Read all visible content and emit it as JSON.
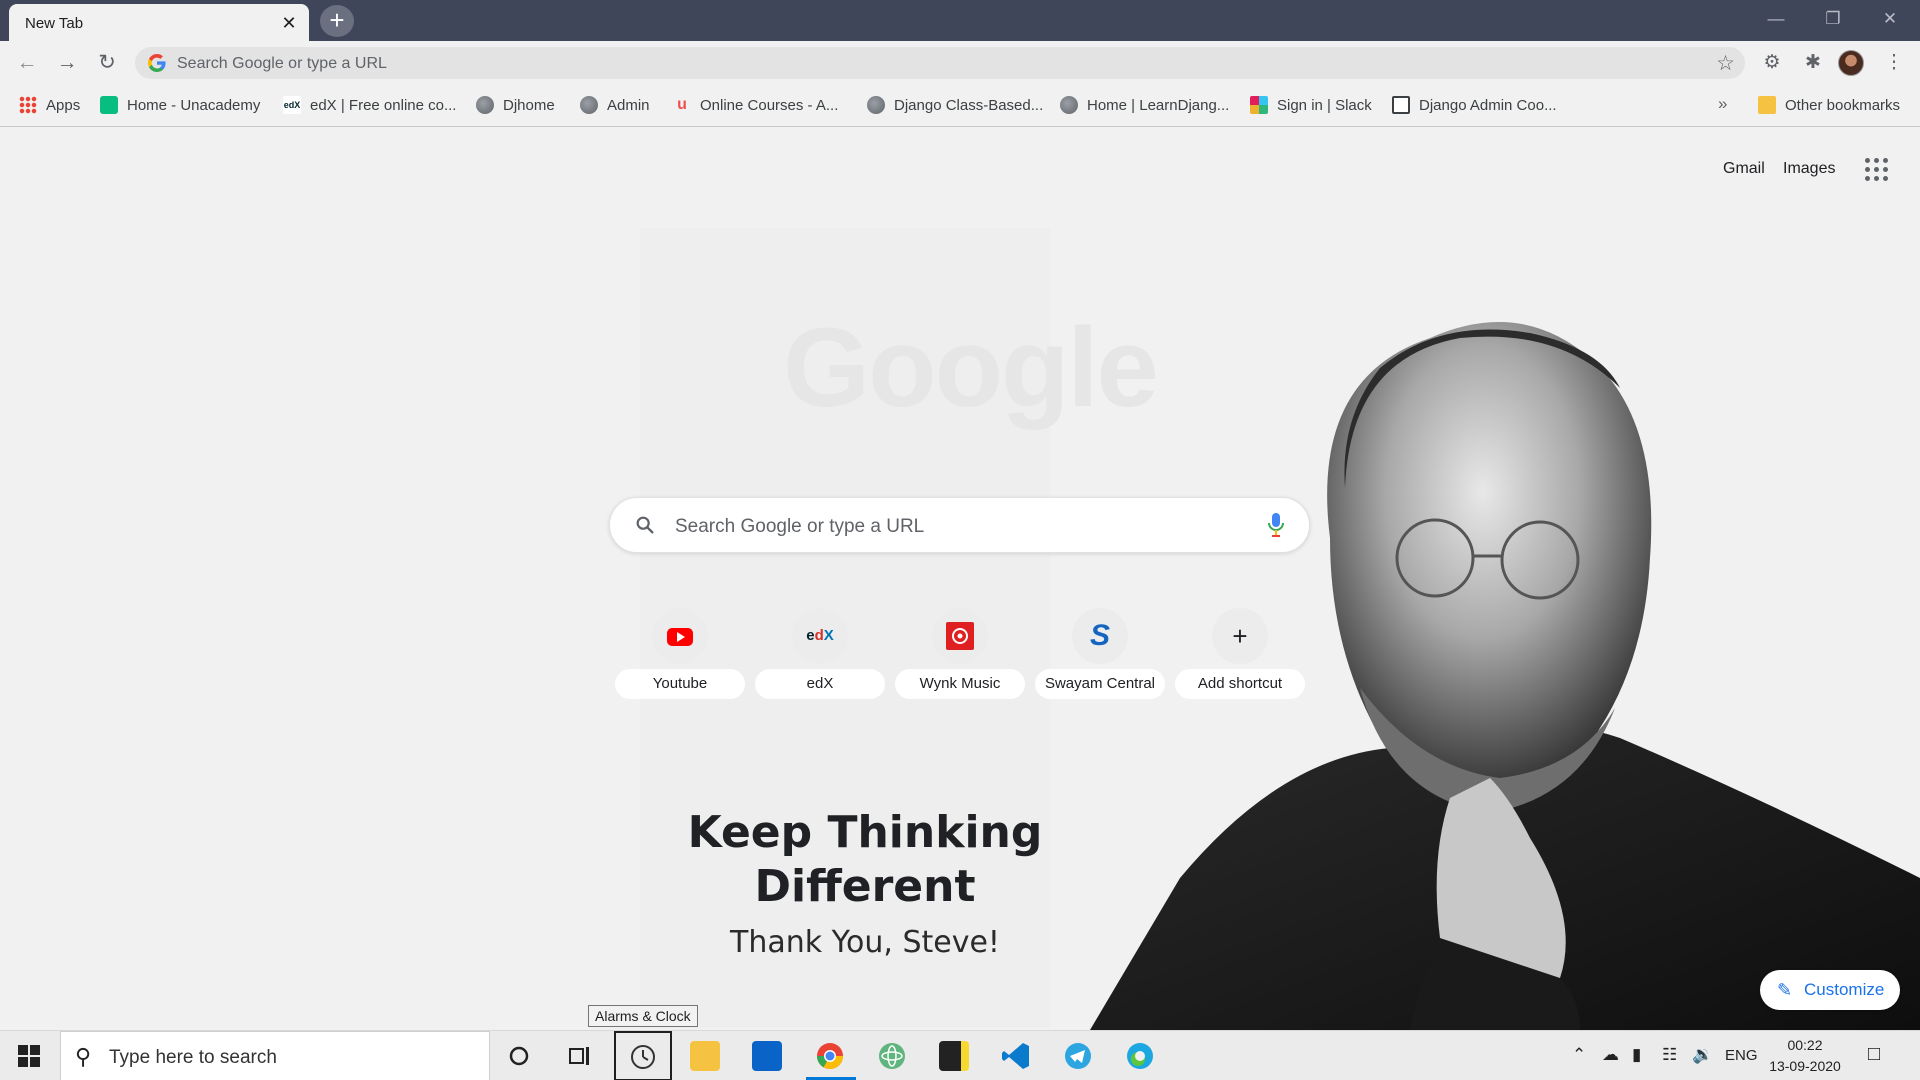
{
  "browser": {
    "tab_title": "New Tab",
    "tab_close": "✕",
    "new_tab": "+",
    "window_controls": [
      "—",
      "❐",
      "✕"
    ],
    "omnibox_placeholder": "Search Google or type a URL",
    "bookmarks": [
      {
        "label": "Apps",
        "icon": "apps-icon"
      },
      {
        "label": "Home - Unacademy",
        "icon": "unacademy-icon"
      },
      {
        "label": "edX | Free online co...",
        "icon": "edx-icon"
      },
      {
        "label": "Djhome",
        "icon": "globe-icon"
      },
      {
        "label": "Admin",
        "icon": "globe-icon"
      },
      {
        "label": "Online Courses - A...",
        "icon": "udemy-icon"
      },
      {
        "label": "Django Class-Based...",
        "icon": "globe-icon"
      },
      {
        "label": "Home | LearnDjang...",
        "icon": "globe-icon"
      },
      {
        "label": "Sign in | Slack",
        "icon": "slack-icon"
      },
      {
        "label": "Django Admin Coo...",
        "icon": "document-icon"
      }
    ],
    "bookmarks_more": "»",
    "other_bookmarks": "Other bookmarks"
  },
  "newtab": {
    "top_links": [
      "Gmail",
      "Images"
    ],
    "logo": "Google",
    "search_placeholder": "Search Google or type a URL",
    "shortcuts": [
      {
        "label": "Youtube",
        "icon": "youtube-icon"
      },
      {
        "label": "edX",
        "icon": "edx-icon"
      },
      {
        "label": "Wynk Music",
        "icon": "wynk-music-icon"
      },
      {
        "label": "Swayam Central",
        "icon": "swayam-icon"
      },
      {
        "label": "Add shortcut",
        "icon": "plus-icon"
      }
    ],
    "quote_line1": "Keep Thinking",
    "quote_line2": "Different",
    "quote_sub": "Thank You, Steve!",
    "customize": "Customize"
  },
  "taskbar": {
    "search_placeholder": "Type here to search",
    "tooltip": "Alarms & Clock",
    "language": "ENG",
    "time": "00:22",
    "date": "13-09-2020"
  },
  "colors": {
    "tabstrip": "#40465a",
    "chrome_bg": "#f1f1f1",
    "accent": "#1a73e8",
    "taskbar_highlight": "#0078d7"
  }
}
